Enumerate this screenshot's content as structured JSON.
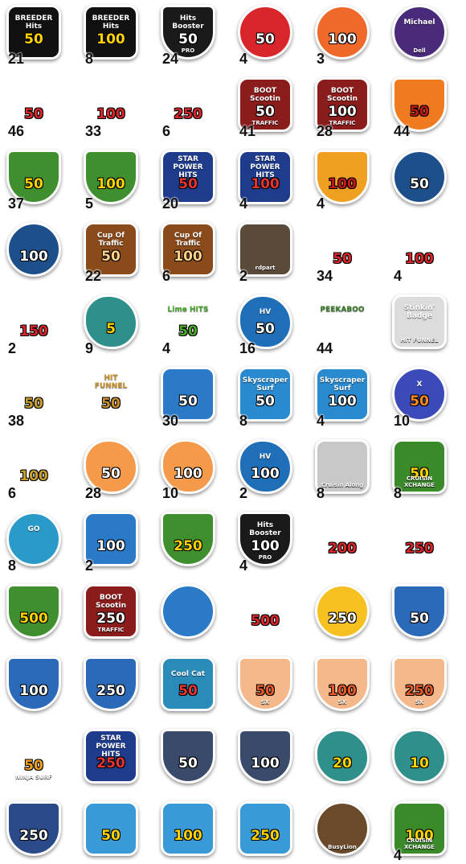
{
  "badges": [
    {
      "art": "BREEDER Hits",
      "value": "50",
      "count": "21",
      "shape": "square",
      "bg": "#111111",
      "fg": "#ffd200",
      "icon": "breeder-hits-icon"
    },
    {
      "art": "BREEDER Hits",
      "value": "100",
      "count": "8",
      "shape": "square",
      "bg": "#111111",
      "fg": "#ffd200",
      "icon": "breeder-hits-icon"
    },
    {
      "art": "Hits Booster",
      "value": "50",
      "sub": "PRO",
      "count": "24",
      "shape": "shield",
      "bg": "#1a1a1a",
      "fg": "#ffffff",
      "icon": "hits-booster-icon"
    },
    {
      "art": "",
      "value": "50",
      "count": "4",
      "shape": "circle",
      "bg": "#d8262b",
      "fg": "#ffffff",
      "icon": "pointing-hand-icon"
    },
    {
      "art": "",
      "value": "100",
      "count": "3",
      "shape": "circle",
      "bg": "#ef6a2a",
      "fg": "#ffffff",
      "icon": "pointing-hand-icon"
    },
    {
      "art": "Michael",
      "value": "",
      "sub": "Dell",
      "count": "",
      "shape": "circle",
      "bg": "#4a2a7a",
      "fg": "#ffffff",
      "icon": "avatar-icon"
    },
    {
      "art": "",
      "value": "50",
      "count": "46",
      "shape": "free",
      "bg": "#ffffff",
      "fg": "#d8262b",
      "icon": "cowgirl-icon"
    },
    {
      "art": "",
      "value": "100",
      "count": "33",
      "shape": "free",
      "bg": "#ffffff",
      "fg": "#d8262b",
      "icon": "cowgirl-icon"
    },
    {
      "art": "",
      "value": "250",
      "count": "6",
      "shape": "free",
      "bg": "#ffffff",
      "fg": "#d8262b",
      "icon": "cowgirl-icon"
    },
    {
      "art": "BOOT Scootin",
      "value": "50",
      "sub": "TRAFFIC",
      "count": "41",
      "shape": "square",
      "bg": "#8a1c1c",
      "fg": "#ffffff",
      "icon": "boot-scootin-icon"
    },
    {
      "art": "BOOT Scootin",
      "value": "100",
      "sub": "TRAFFIC",
      "count": "28",
      "shape": "square",
      "bg": "#8a1c1c",
      "fg": "#ffffff",
      "icon": "boot-scootin-icon"
    },
    {
      "art": "",
      "value": "50",
      "count": "44",
      "shape": "shield",
      "bg": "#f07a20",
      "fg": "#c01818",
      "icon": "shield-icon"
    },
    {
      "art": "",
      "value": "50",
      "count": "37",
      "shape": "shield",
      "bg": "#3f8f2e",
      "fg": "#ffd200",
      "icon": "trophy-icon"
    },
    {
      "art": "",
      "value": "100",
      "count": "5",
      "shape": "shield",
      "bg": "#3f8f2e",
      "fg": "#ffd200",
      "icon": "trophy-icon"
    },
    {
      "art": "STAR POWER HITS",
      "value": "50",
      "count": "20",
      "shape": "square",
      "bg": "#1f3c8c",
      "fg": "#e8342e",
      "icon": "star-icon"
    },
    {
      "art": "STAR POWER HITS",
      "value": "100",
      "count": "4",
      "shape": "square",
      "bg": "#1f3c8c",
      "fg": "#e8342e",
      "icon": "star-icon"
    },
    {
      "art": "",
      "value": "100",
      "count": "4",
      "shape": "shield",
      "bg": "#f0a020",
      "fg": "#c01818",
      "icon": "bomb-icon"
    },
    {
      "art": "",
      "value": "50",
      "count": "",
      "shape": "circle",
      "bg": "#1d4f8a",
      "fg": "#ffffff",
      "icon": "superhero-icon"
    },
    {
      "art": "",
      "value": "100",
      "count": "",
      "shape": "circle",
      "bg": "#1d4f8a",
      "fg": "#ffffff",
      "icon": "superhero-icon"
    },
    {
      "art": "Cup Of Traffic",
      "value": "50",
      "count": "22",
      "shape": "square",
      "bg": "#8a4a1a",
      "fg": "#ffd28a",
      "icon": "cup-icon"
    },
    {
      "art": "Cup Of Traffic",
      "value": "100",
      "count": "6",
      "shape": "square",
      "bg": "#8a4a1a",
      "fg": "#ffd28a",
      "icon": "cup-icon"
    },
    {
      "art": "",
      "value": "",
      "sub": "rdpart",
      "count": "2",
      "shape": "square",
      "bg": "#5a4a3a",
      "fg": "#ffffff",
      "icon": "avatar-icon"
    },
    {
      "art": "",
      "value": "50",
      "count": "34",
      "shape": "free",
      "bg": "#ffffff",
      "fg": "#d8262b",
      "icon": "dome-icon"
    },
    {
      "art": "",
      "value": "100",
      "count": "4",
      "shape": "free",
      "bg": "#ffffff",
      "fg": "#d8262b",
      "icon": "dome-icon"
    },
    {
      "art": "",
      "value": "150",
      "count": "2",
      "shape": "free",
      "bg": "#ffffff",
      "fg": "#d8262b",
      "icon": "dome-icon"
    },
    {
      "art": "",
      "value": "5",
      "count": "9",
      "shape": "flower",
      "bg": "#2f8f8a",
      "fg": "#ffd200",
      "icon": "professor-icon"
    },
    {
      "art": "Lime HITS",
      "value": "50",
      "count": "4",
      "shape": "free",
      "bg": "#ffffff",
      "fg": "#4aa82a",
      "icon": "lime-icon"
    },
    {
      "art": "HV",
      "value": "50",
      "count": "16",
      "shape": "flower",
      "bg": "#1f6fb8",
      "fg": "#ffffff",
      "icon": "hitvision-icon"
    },
    {
      "art": "PEEKABOO",
      "value": "",
      "count": "44",
      "shape": "free",
      "bg": "#ffffff",
      "fg": "#3a7a2a",
      "icon": "turtle-icon"
    },
    {
      "art": "Stinkin' Badge",
      "value": "",
      "sub": "HIT FUNNEL",
      "count": "",
      "shape": "square",
      "bg": "#dcdcdc",
      "fg": "#111111",
      "icon": "bandit-icon"
    },
    {
      "art": "",
      "value": "50",
      "count": "38",
      "shape": "free",
      "bg": "#ffffff",
      "fg": "#c8a030",
      "icon": "turtle-icon"
    },
    {
      "art": "HIT FUNNEL",
      "value": "50",
      "count": "",
      "shape": "free",
      "bg": "#ffffff",
      "fg": "#c8902a",
      "icon": "funnel-icon"
    },
    {
      "art": "",
      "value": "50",
      "count": "30",
      "shape": "square",
      "bg": "#2a7ac8",
      "fg": "#ffffff",
      "icon": "surfer-icon"
    },
    {
      "art": "Skyscraper Surf",
      "value": "50",
      "count": "8",
      "shape": "square",
      "bg": "#2a8ad0",
      "fg": "#ffffff",
      "icon": "skyscraper-icon"
    },
    {
      "art": "Skyscraper Surf",
      "value": "100",
      "count": "4",
      "shape": "square",
      "bg": "#2a8ad0",
      "fg": "#ffffff",
      "icon": "skyscraper-icon"
    },
    {
      "art": "X",
      "value": "50",
      "count": "10",
      "shape": "circle",
      "bg": "#3a4ab8",
      "fg": "#ff8a20",
      "icon": "x-icon"
    },
    {
      "art": "",
      "value": "100",
      "count": "6",
      "shape": "free",
      "bg": "#ffffff",
      "fg": "#c8a030",
      "icon": "turtle-icon"
    },
    {
      "art": "",
      "value": "50",
      "count": "28",
      "shape": "flower",
      "bg": "#f59a4a",
      "fg": "#ffffff",
      "icon": "flower-icon"
    },
    {
      "art": "",
      "value": "100",
      "count": "10",
      "shape": "flower",
      "bg": "#f59a4a",
      "fg": "#ffffff",
      "icon": "flower-icon"
    },
    {
      "art": "HV",
      "value": "100",
      "count": "2",
      "shape": "flower",
      "bg": "#1f6fb8",
      "fg": "#ffffff",
      "icon": "hitvision-icon"
    },
    {
      "art": "",
      "value": "",
      "sub": "Cruisin Along",
      "count": "8",
      "shape": "square",
      "bg": "#c8c8c8",
      "fg": "#d8262b",
      "icon": "race-car-icon"
    },
    {
      "art": "",
      "value": "50",
      "sub": "CRUISIN XCHANGE",
      "count": "8",
      "shape": "square",
      "bg": "#3a8a2a",
      "fg": "#ffd200",
      "icon": "race-car-icon"
    },
    {
      "art": "GO",
      "value": "",
      "count": "8",
      "shape": "circle",
      "bg": "#2a9ac8",
      "fg": "#d8262b",
      "icon": "go-icon"
    },
    {
      "art": "",
      "value": "100",
      "count": "2",
      "shape": "square",
      "bg": "#2a7ac8",
      "fg": "#ffffff",
      "icon": "surfer-icon"
    },
    {
      "art": "",
      "value": "250",
      "count": "",
      "shape": "shield",
      "bg": "#3f8f2e",
      "fg": "#ffd200",
      "icon": "trophy-icon"
    },
    {
      "art": "Hits Booster",
      "value": "100",
      "sub": "PRO",
      "count": "4",
      "shape": "shield",
      "bg": "#1a1a1a",
      "fg": "#ffffff",
      "icon": "hits-booster-icon"
    },
    {
      "art": "",
      "value": "200",
      "count": "",
      "shape": "free",
      "bg": "#ffffff",
      "fg": "#d8262b",
      "icon": "dome-icon"
    },
    {
      "art": "",
      "value": "250",
      "count": "",
      "shape": "free",
      "bg": "#ffffff",
      "fg": "#d8262b",
      "icon": "dome-icon"
    },
    {
      "art": "",
      "value": "500",
      "count": "",
      "shape": "shield",
      "bg": "#3f8f2e",
      "fg": "#ffd200",
      "icon": "trophy-icon"
    },
    {
      "art": "BOOT Scootin",
      "value": "250",
      "sub": "TRAFFIC",
      "count": "",
      "shape": "square",
      "bg": "#8a1c1c",
      "fg": "#ffffff",
      "icon": "boot-scootin-icon"
    },
    {
      "art": "",
      "value": "",
      "count": "",
      "shape": "circle",
      "bg": "#2a7ac8",
      "fg": "#ffffff",
      "icon": "pointing-hand-icon"
    },
    {
      "art": "",
      "value": "500",
      "count": "",
      "shape": "free",
      "bg": "#ffffff",
      "fg": "#d8262b",
      "icon": "dome-icon"
    },
    {
      "art": "",
      "value": "250",
      "count": "",
      "shape": "circle",
      "bg": "#f5c020",
      "fg": "#ffffff",
      "icon": "pointing-hand-icon"
    },
    {
      "art": "",
      "value": "50",
      "count": "",
      "shape": "shield",
      "bg": "#2a6ab8",
      "fg": "#ffffff",
      "icon": "man-icon"
    },
    {
      "art": "",
      "value": "100",
      "count": "",
      "shape": "shield",
      "bg": "#2a6ab8",
      "fg": "#ffffff",
      "icon": "man-icon"
    },
    {
      "art": "",
      "value": "250",
      "count": "",
      "shape": "shield",
      "bg": "#2a6ab8",
      "fg": "#ffffff",
      "icon": "man-icon"
    },
    {
      "art": "Cool Cat",
      "value": "50",
      "count": "",
      "shape": "square",
      "bg": "#2a8ab8",
      "fg": "#e8342e",
      "icon": "cat-icon"
    },
    {
      "art": "",
      "value": "50",
      "sub": "SX",
      "count": "",
      "shape": "shield",
      "bg": "#f5b88a",
      "fg": "#e85a2a",
      "icon": "sx-icon"
    },
    {
      "art": "",
      "value": "100",
      "sub": "SX",
      "count": "",
      "shape": "shield",
      "bg": "#f5b88a",
      "fg": "#e85a2a",
      "icon": "sx-icon"
    },
    {
      "art": "",
      "value": "250",
      "sub": "SX",
      "count": "",
      "shape": "shield",
      "bg": "#f5b88a",
      "fg": "#e85a2a",
      "icon": "sx-icon"
    },
    {
      "art": "",
      "value": "50",
      "sub": "NINJA SURF",
      "count": "",
      "shape": "free",
      "bg": "#ffffff",
      "fg": "#f0a020",
      "icon": "ninja-icon"
    },
    {
      "art": "STAR POWER HITS",
      "value": "250",
      "count": "",
      "shape": "square",
      "bg": "#1f3c8c",
      "fg": "#e8342e",
      "icon": "star-icon"
    },
    {
      "art": "",
      "value": "50",
      "count": "",
      "shape": "shield",
      "bg": "#3a4a6a",
      "fg": "#ffffff",
      "icon": "b-icon"
    },
    {
      "art": "",
      "value": "100",
      "count": "",
      "shape": "shield",
      "bg": "#3a4a6a",
      "fg": "#ffffff",
      "icon": "b-icon"
    },
    {
      "art": "",
      "value": "20",
      "count": "",
      "shape": "flower",
      "bg": "#2f8f8a",
      "fg": "#ffd200",
      "icon": "professor-icon"
    },
    {
      "art": "",
      "value": "10",
      "count": "",
      "shape": "flower",
      "bg": "#2f8f8a",
      "fg": "#ffd200",
      "icon": "professor-icon"
    },
    {
      "art": "",
      "value": "250",
      "count": "",
      "shape": "shield",
      "bg": "#2a4a8a",
      "fg": "#ffffff",
      "icon": "b-icon"
    },
    {
      "art": "",
      "value": "50",
      "count": "",
      "shape": "square",
      "bg": "#3a9ad8",
      "fg": "#ffd200",
      "icon": "volcano-icon"
    },
    {
      "art": "",
      "value": "100",
      "count": "",
      "shape": "square",
      "bg": "#3a9ad8",
      "fg": "#ffd200",
      "icon": "volcano-icon"
    },
    {
      "art": "",
      "value": "250",
      "count": "",
      "shape": "square",
      "bg": "#3a9ad8",
      "fg": "#ffd200",
      "icon": "volcano-icon"
    },
    {
      "art": "",
      "value": "",
      "sub": "BusyLion",
      "count": "",
      "shape": "circle",
      "bg": "#6a4a2a",
      "fg": "#ffffff",
      "icon": "lion-icon"
    },
    {
      "art": "",
      "value": "100",
      "sub": "CRUISIN XCHANGE",
      "count": "4",
      "shape": "square",
      "bg": "#3a8a2a",
      "fg": "#ffd200",
      "icon": "race-car-icon"
    }
  ]
}
